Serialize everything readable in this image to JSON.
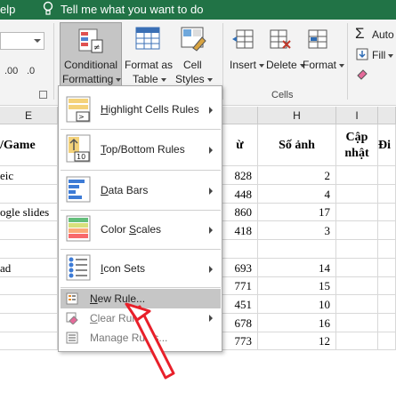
{
  "title_bar": {
    "help": "elp",
    "tell_me": "Tell me what you want to do"
  },
  "ribbon": {
    "number_format": {
      "decrease": ".00",
      "increase": ".0"
    },
    "conditional_formatting": {
      "line1": "Conditional",
      "line2": "Formatting"
    },
    "format_as_table": {
      "line1": "Format as",
      "line2": "Table"
    },
    "cell_styles": {
      "line1": "Cell",
      "line2": "Styles"
    },
    "insert": "Insert",
    "delete": "Delete",
    "format": "Format",
    "cells_group": "Cells",
    "editing": {
      "autosum": "Auto",
      "fill": "Fill",
      "clear": ""
    }
  },
  "menu": {
    "items": [
      {
        "prefix": "",
        "hot": "H",
        "rest": "ighlight Cells Rules",
        "has_submenu": true,
        "icon": "highlight-cells-icon"
      },
      {
        "prefix": "",
        "hot": "T",
        "rest": "op/Bottom Rules",
        "has_submenu": true,
        "icon": "top-bottom-icon"
      },
      {
        "prefix": "",
        "hot": "D",
        "rest": "ata Bars",
        "has_submenu": true,
        "icon": "data-bars-icon"
      },
      {
        "prefix": "Color ",
        "hot": "S",
        "rest": "cales",
        "has_submenu": true,
        "icon": "color-scales-icon"
      },
      {
        "prefix": "",
        "hot": "I",
        "rest": "con Sets",
        "has_submenu": true,
        "icon": "icon-sets-icon"
      },
      {
        "prefix": "",
        "hot": "N",
        "rest": "ew Rule...",
        "has_submenu": false,
        "icon": "new-rule-icon",
        "highlighted": true
      },
      {
        "prefix": "",
        "hot": "C",
        "rest": "lear Rules",
        "has_submenu": true,
        "icon": "clear-rules-icon"
      },
      {
        "prefix": "Manage Rul",
        "hot": "",
        "rest": "es...",
        "has_submenu": false,
        "icon": "manage-rules-icon"
      }
    ]
  },
  "sheet": {
    "columns": {
      "E": "E",
      "H": "H",
      "I": "I"
    },
    "headers": {
      "e": "/Game",
      "g_partial": "ừ",
      "h": "Số ảnh",
      "i_line1": "Cập",
      "i_line2": "nhật",
      "j_partial": "Đi"
    },
    "col_e": [
      "eic",
      "",
      "ogle slides",
      "",
      "",
      "ad",
      "",
      "",
      "",
      ""
    ],
    "col_g": [
      "828",
      "448",
      "860",
      "418",
      "",
      "693",
      "771",
      "451",
      "678",
      "773"
    ],
    "col_h": [
      "2",
      "4",
      "17",
      "3",
      "",
      "14",
      "15",
      "10",
      "16",
      "12"
    ]
  },
  "colors": {
    "excel_green": "#217346",
    "arrow_red": "#e8202a",
    "menu_highlight": "#c6c6c6"
  }
}
